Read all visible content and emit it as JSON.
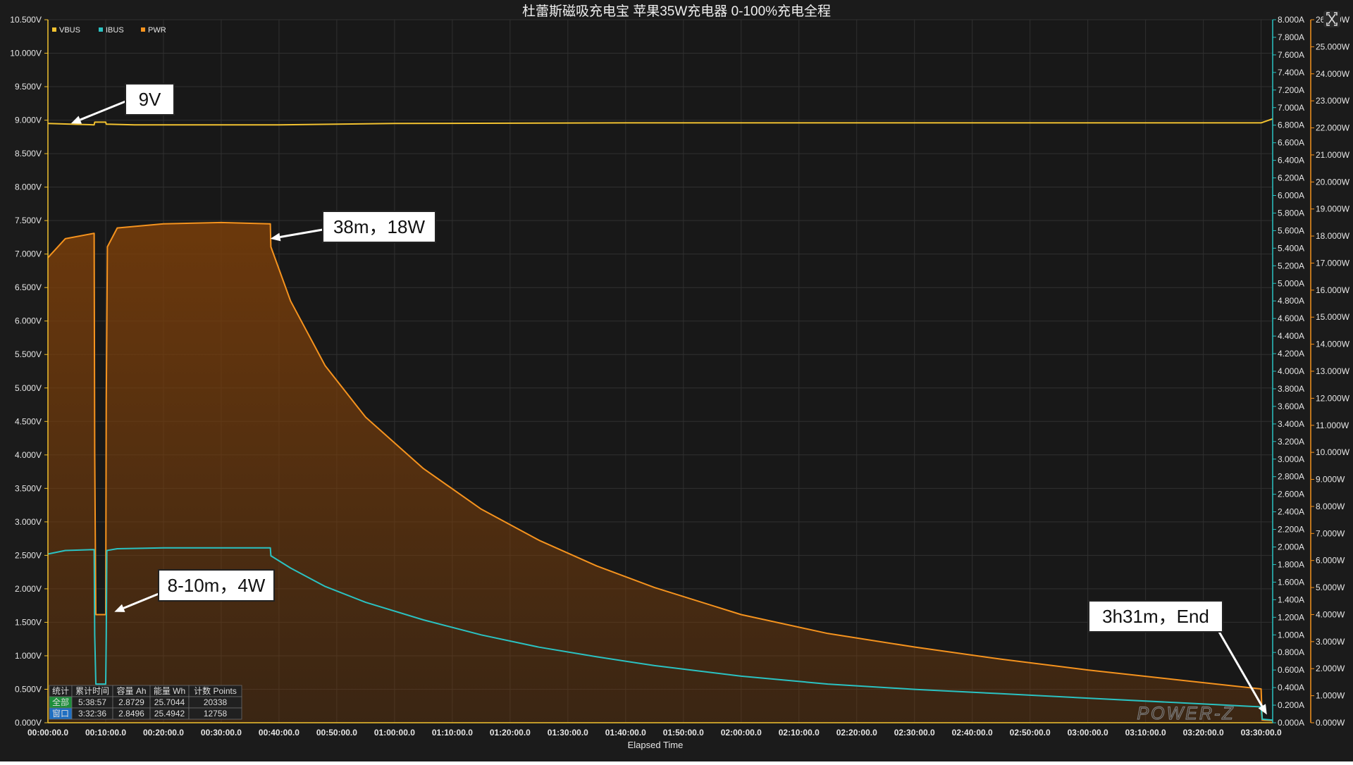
{
  "colors": {
    "background": "#1b1b1b",
    "plot_background": "#181818",
    "grid": "#303030",
    "vbus": "#f2c230",
    "ibus": "#2bc2c2",
    "pwr": "#f5931e",
    "pwr_fill": "#7a3e0a",
    "axis_left": "#f2c230",
    "axis_right_current": "#2bc2c2",
    "axis_right_power": "#f5931e"
  },
  "toolbar": {
    "fullscreen_icon": "fullscreen-icon"
  },
  "chart_data": {
    "type": "line",
    "title": "杜蕾斯磁吸充电宝 苹果35W充电器 0-100%充电全程",
    "xlabel": "Elapsed Time",
    "x_range_min": [
      0,
      212
    ],
    "x_ticks": [
      "00:00:00.0",
      "00:10:00.0",
      "00:20:00.0",
      "00:30:00.0",
      "00:40:00.0",
      "00:50:00.0",
      "01:00:00.0",
      "01:10:00.0",
      "01:20:00.0",
      "01:30:00.0",
      "01:40:00.0",
      "01:50:00.0",
      "02:00:00.0",
      "02:10:00.0",
      "02:20:00.0",
      "02:30:00.0",
      "02:40:00.0",
      "02:50:00.0",
      "03:00:00.0",
      "03:10:00.0",
      "03:20:00.0",
      "03:30:00.0"
    ],
    "y_left": {
      "unit": "V",
      "range": [
        0,
        10.5
      ],
      "ticks": [
        "0.000V",
        "0.500V",
        "1.000V",
        "1.500V",
        "2.000V",
        "2.500V",
        "3.000V",
        "3.500V",
        "4.000V",
        "4.500V",
        "5.000V",
        "5.500V",
        "6.000V",
        "6.500V",
        "7.000V",
        "7.500V",
        "8.000V",
        "8.500V",
        "9.000V",
        "9.500V",
        "10.000V",
        "10.500V"
      ]
    },
    "y_right_current": {
      "unit": "A",
      "range": [
        0,
        8.0
      ],
      "ticks": [
        "0.000A",
        "0.200A",
        "0.400A",
        "0.600A",
        "0.800A",
        "1.000A",
        "1.200A",
        "1.400A",
        "1.600A",
        "1.800A",
        "2.000A",
        "2.200A",
        "2.400A",
        "2.600A",
        "2.800A",
        "3.000A",
        "3.200A",
        "3.400A",
        "3.600A",
        "3.800A",
        "4.000A",
        "4.200A",
        "4.400A",
        "4.600A",
        "4.800A",
        "5.000A",
        "5.200A",
        "5.400A",
        "5.600A",
        "5.800A",
        "6.000A",
        "6.200A",
        "6.400A",
        "6.600A",
        "6.800A",
        "7.000A",
        "7.200A",
        "7.400A",
        "7.600A",
        "7.800A",
        "8.000A"
      ]
    },
    "y_right_power": {
      "unit": "W",
      "range": [
        0,
        26.0
      ],
      "ticks": [
        "0.000W",
        "1.000W",
        "2.000W",
        "3.000W",
        "4.000W",
        "5.000W",
        "6.000W",
        "7.000W",
        "8.000W",
        "9.000W",
        "10.000W",
        "11.000W",
        "12.000W",
        "13.000W",
        "14.000W",
        "15.000W",
        "16.000W",
        "17.000W",
        "18.000W",
        "19.000W",
        "20.000W",
        "21.000W",
        "22.000W",
        "23.000W",
        "24.000W",
        "25.000W",
        "26.000W"
      ]
    },
    "legend": [
      "VBUS",
      "IBUS",
      "PWR"
    ],
    "legend_position": "top-left",
    "grid": true,
    "series": [
      {
        "name": "VBUS",
        "axis": "left",
        "x": [
          0,
          4,
          8,
          8.1,
          10,
          10.1,
          15,
          40,
          60,
          100,
          150,
          210,
          212
        ],
        "y": [
          8.95,
          8.94,
          8.93,
          8.97,
          8.97,
          8.94,
          8.93,
          8.93,
          8.95,
          8.96,
          8.96,
          8.96,
          9.02
        ]
      },
      {
        "name": "IBUS",
        "axis": "right_current",
        "x": [
          0,
          3,
          8,
          8.1,
          8.3,
          10,
          10.1,
          10.2,
          12,
          20,
          30,
          38.5,
          38.6,
          42,
          48,
          55,
          65,
          75,
          85,
          95,
          105,
          120,
          135,
          150,
          165,
          180,
          195,
          210,
          210.2,
          212
        ],
        "y": [
          1.92,
          1.96,
          1.97,
          1.0,
          0.44,
          0.44,
          1.0,
          1.96,
          1.98,
          1.99,
          1.99,
          1.99,
          1.9,
          1.76,
          1.55,
          1.37,
          1.17,
          1.0,
          0.86,
          0.75,
          0.65,
          0.53,
          0.44,
          0.38,
          0.33,
          0.28,
          0.23,
          0.18,
          0.04,
          0.03
        ]
      },
      {
        "name": "PWR",
        "axis": "right_power",
        "x": [
          0,
          3,
          8,
          8.1,
          8.3,
          10,
          10.1,
          10.3,
          12,
          20,
          30,
          38.5,
          38.6,
          42,
          48,
          55,
          65,
          75,
          85,
          95,
          105,
          120,
          135,
          150,
          165,
          180,
          195,
          210,
          210.2,
          212
        ],
        "y": [
          17.2,
          17.9,
          18.1,
          10.0,
          4.0,
          4.0,
          12.0,
          17.6,
          18.3,
          18.45,
          18.5,
          18.45,
          17.6,
          15.6,
          13.2,
          11.3,
          9.4,
          7.9,
          6.75,
          5.8,
          5.0,
          4.0,
          3.3,
          2.8,
          2.35,
          1.95,
          1.6,
          1.25,
          0.1,
          0.08
        ]
      }
    ],
    "annotations": [
      {
        "text": "9V",
        "target": {
          "x": 4,
          "y_left": 8.95
        }
      },
      {
        "text": "38m，18W",
        "target": {
          "x": 38.5,
          "y_power": 17.9
        }
      },
      {
        "text": "8-10m，4W",
        "target": {
          "x": 11.5,
          "y_power": 4.1
        }
      },
      {
        "text": "3h31m，End",
        "target": {
          "x": 211,
          "y_power": 0.3
        }
      }
    ],
    "stats_table": {
      "headers": [
        "统计",
        "累计时间",
        "容量 Ah",
        "能量 Wh",
        "计数 Points"
      ],
      "rows": [
        [
          "全部",
          "5:38:57",
          "2.8729",
          "25.7044",
          "20338"
        ],
        [
          "窗口",
          "3:32:36",
          "2.8496",
          "25.4942",
          "12758"
        ]
      ]
    },
    "watermark": "POWER-Z"
  }
}
